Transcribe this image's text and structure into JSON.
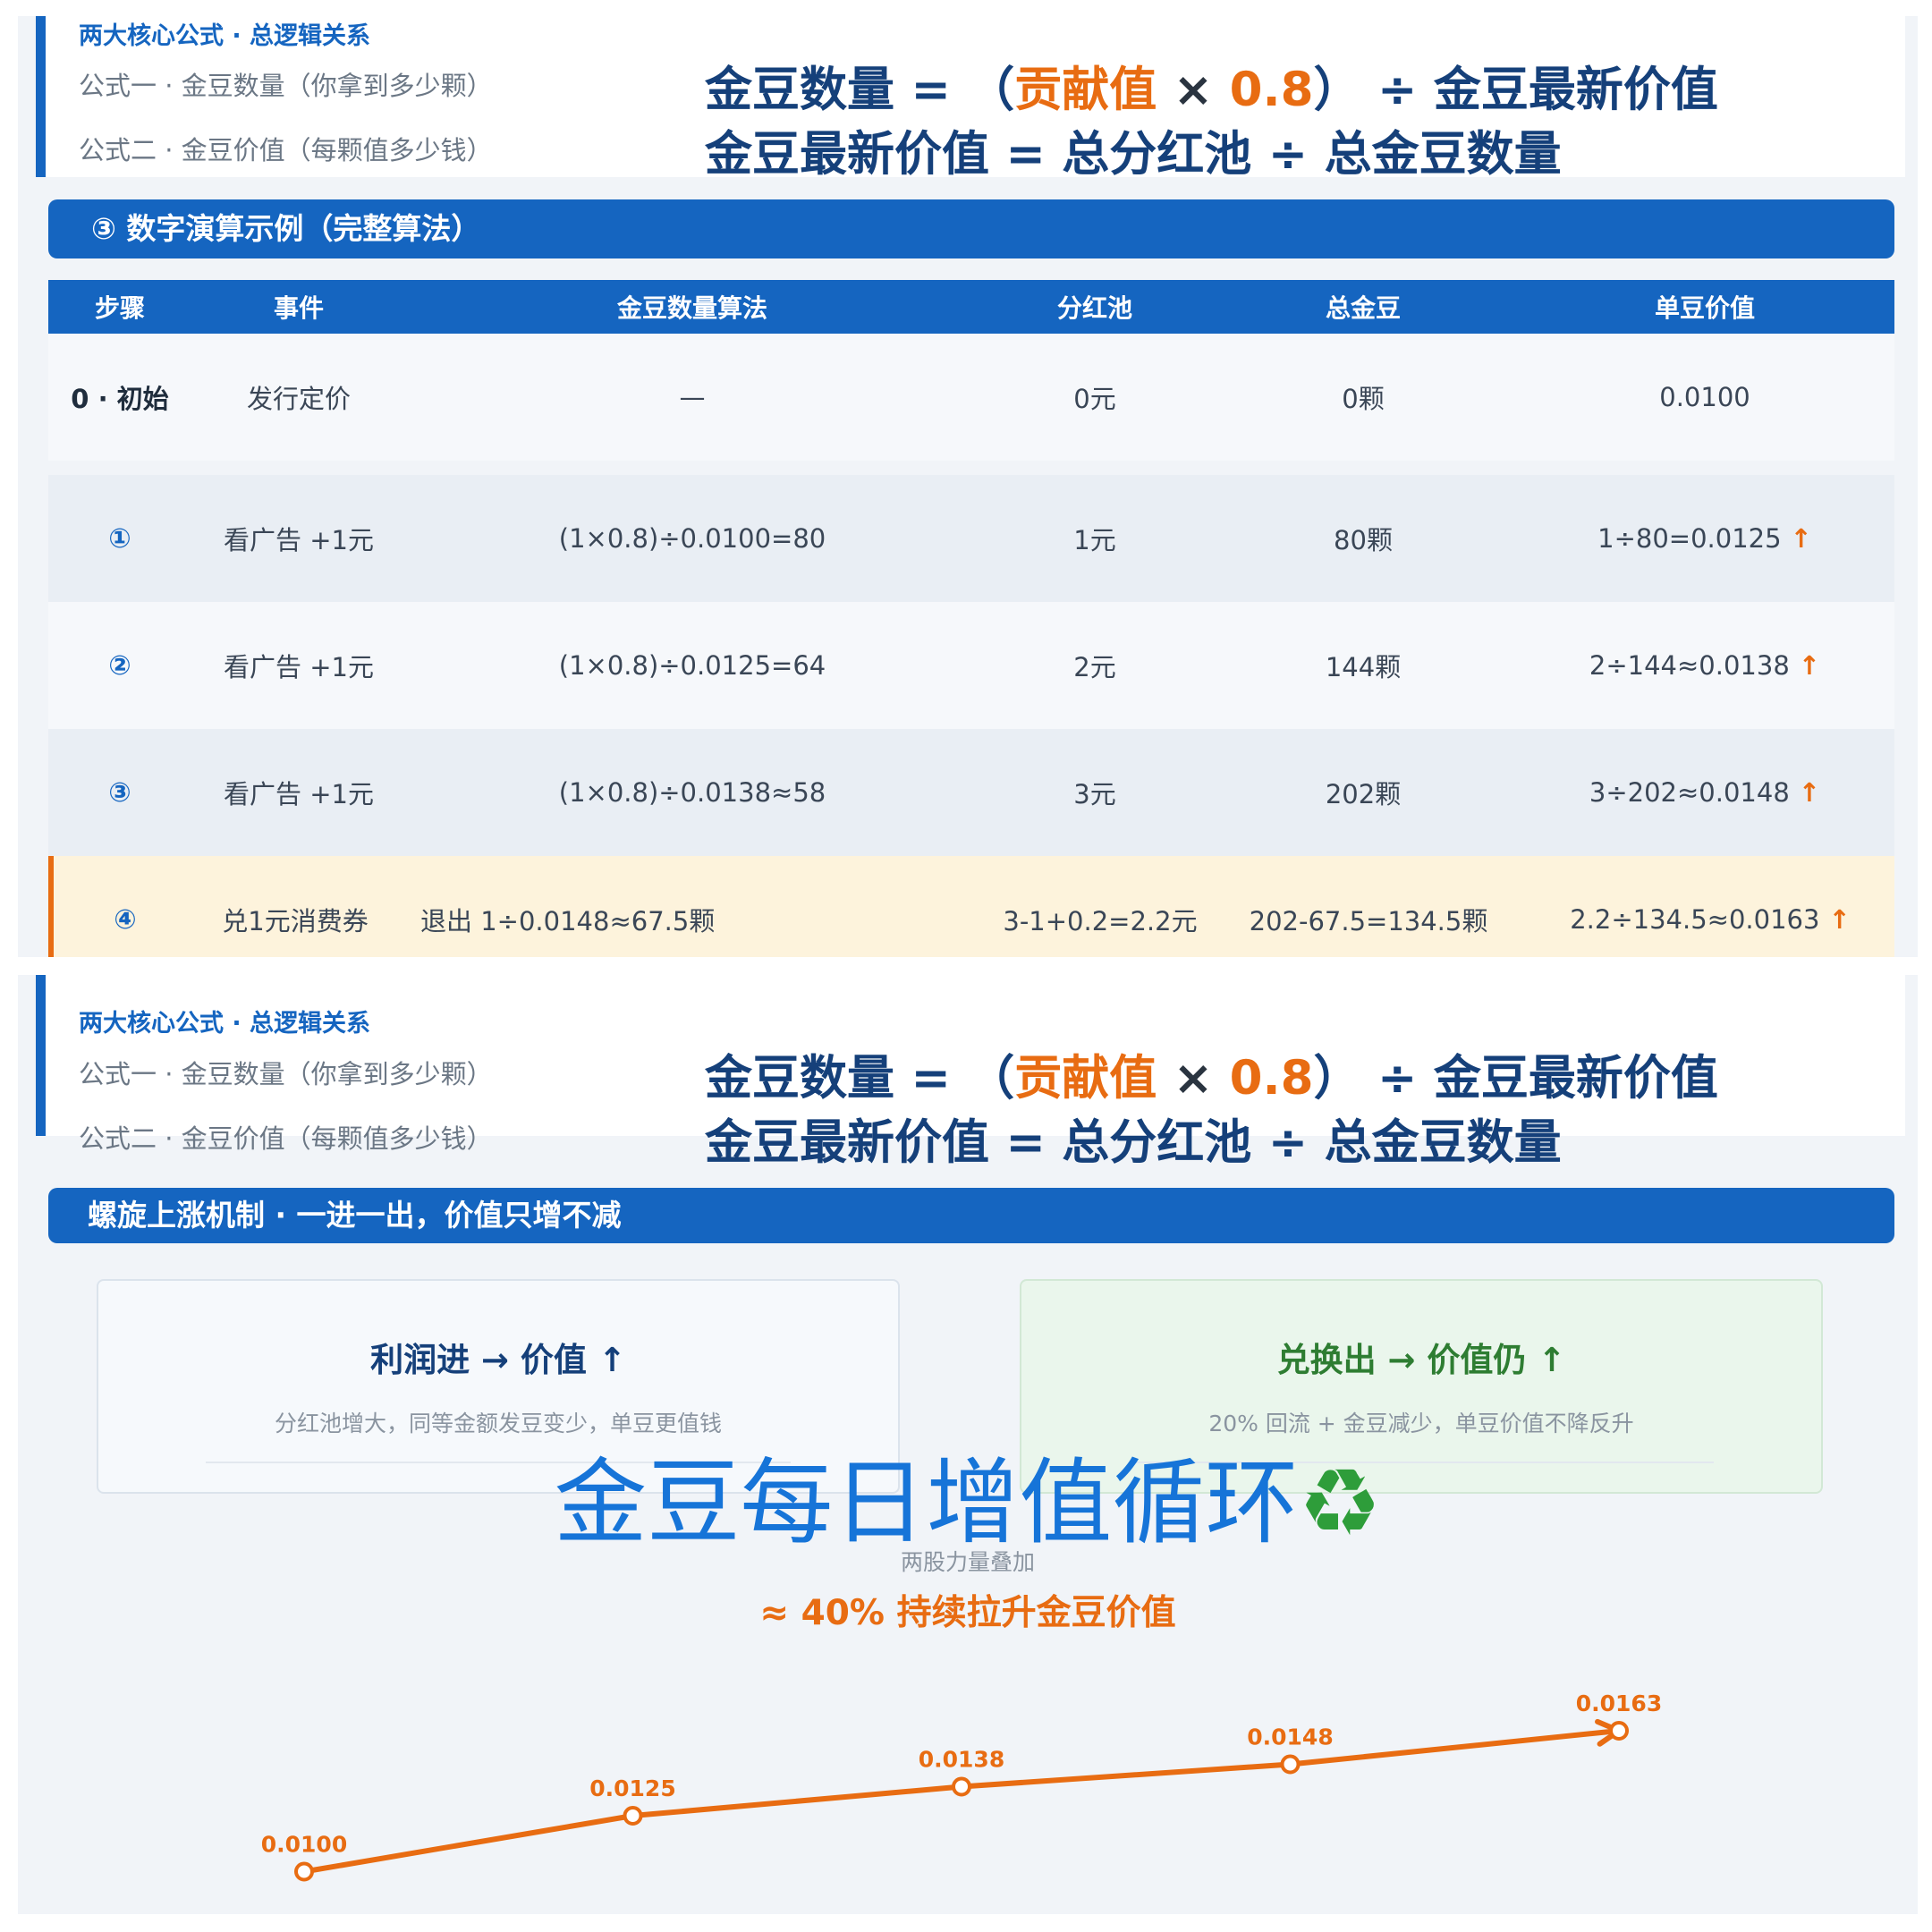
{
  "header": {
    "title": "两大核心公式 · 总逻辑关系",
    "formula1": {
      "label": "公式一 · 金豆数量（你拿到多少颗）",
      "lhs": "金豆数量 = （",
      "term": "贡献值",
      "times": " × ",
      "factor": "0.8",
      "rhs": "） ÷ 金豆最新价值"
    },
    "formula2": {
      "label": "公式二 · 金豆价值（每颗值多少钱）",
      "expr": "金豆最新价值 = 总分红池 ÷ 总金豆数量"
    }
  },
  "section1": {
    "title": "③ 数字演算示例（完整算法）"
  },
  "table": {
    "columns": [
      "步骤",
      "事件",
      "金豆数量算法",
      "分红池",
      "总金豆",
      "单豆价值"
    ],
    "rows": [
      {
        "step": "0 · 初始",
        "event": "发行定价",
        "formula": "—",
        "pool": "0元",
        "beans": "0颗",
        "value": "0.0100",
        "up": ""
      },
      {
        "step": "①",
        "event": "看广告 +1元",
        "formula": "(1×0.8)÷0.0100=80",
        "pool": "1元",
        "beans": "80颗",
        "value": "1÷80=0.0125",
        "up": "↑"
      },
      {
        "step": "②",
        "event": "看广告 +1元",
        "formula": "(1×0.8)÷0.0125=64",
        "pool": "2元",
        "beans": "144颗",
        "value": "2÷144≈0.0138",
        "up": "↑"
      },
      {
        "step": "③",
        "event": "看广告 +1元",
        "formula": "(1×0.8)÷0.0138≈58",
        "pool": "3元",
        "beans": "202颗",
        "value": "3÷202≈0.0148",
        "up": "↑"
      },
      {
        "step": "④",
        "event": "兑1元消费券",
        "formula": "退出 1÷0.0148≈67.5颗",
        "pool": "3-1+0.2=2.2元",
        "beans": "202-67.5=134.5颗",
        "value": "2.2÷134.5≈0.0163",
        "up": "↑"
      }
    ]
  },
  "section2": {
    "title": "螺旋上涨机制 · 一进一出，价值只增不减"
  },
  "mechanism": {
    "left": {
      "title": "利润进 → 价值 ↑",
      "desc": "分红池增大，同等金额发豆变少，单豆更值钱",
      "color": "#15407a"
    },
    "right": {
      "title": "兑换出 → 价值仍 ↑",
      "desc": "20% 回流 + 金豆减少，单豆价值不降反升",
      "color": "#2e7d32"
    }
  },
  "overlay": {
    "text": "金豆每日增值循环",
    "icon": "recycle-icon",
    "glyph": "♻"
  },
  "note": "两股力量叠加",
  "summary": "≈ 40% 持续拉升金豆价值",
  "colors": {
    "brand": "#1565c0",
    "accent": "#e86c12",
    "highlight_row": "#fdf3dc",
    "green_card": "#eaf6ec",
    "blue_card": "#f6f9fc"
  },
  "chart_data": {
    "type": "line",
    "x": [
      0,
      1,
      2,
      3,
      4
    ],
    "values": [
      0.01,
      0.0125,
      0.0138,
      0.0148,
      0.0163
    ],
    "labels": [
      "0.0100",
      "0.0125",
      "0.0138",
      "0.0148",
      "0.0163"
    ],
    "ylim": [
      0.0095,
      0.0165
    ],
    "arrow_end": true,
    "color": "#e86c12"
  }
}
